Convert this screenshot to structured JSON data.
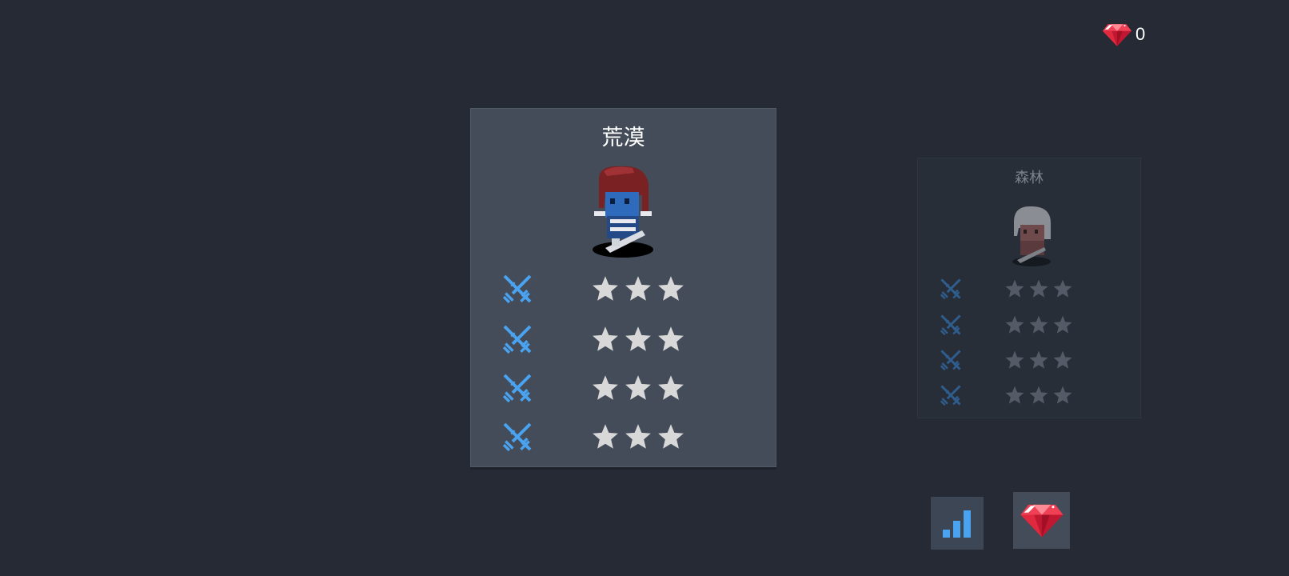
{
  "currency": {
    "icon": "ruby-gem-icon",
    "count": "0",
    "color": "#e0283e"
  },
  "levels": [
    {
      "name": "荒漠",
      "state": "selected",
      "character_icon": "blue-skinned-swordsman-icon",
      "rows": [
        {
          "icon": "crossed-swords-icon",
          "stars_earned": 0,
          "stars_total": 3
        },
        {
          "icon": "crossed-swords-icon",
          "stars_earned": 0,
          "stars_total": 3
        },
        {
          "icon": "crossed-swords-icon",
          "stars_earned": 0,
          "stars_total": 3
        },
        {
          "icon": "crossed-swords-icon",
          "stars_earned": 0,
          "stars_total": 3
        }
      ]
    },
    {
      "name": "森林",
      "state": "dimmed",
      "character_icon": "white-haired-swordsman-icon",
      "rows": [
        {
          "icon": "crossed-swords-icon",
          "stars_earned": 0,
          "stars_total": 3
        },
        {
          "icon": "crossed-swords-icon",
          "stars_earned": 0,
          "stars_total": 3
        },
        {
          "icon": "crossed-swords-icon",
          "stars_earned": 0,
          "stars_total": 3
        },
        {
          "icon": "crossed-swords-icon",
          "stars_earned": 0,
          "stars_total": 3
        }
      ]
    }
  ],
  "buttons": [
    {
      "name": "stats",
      "icon": "bar-chart-icon"
    },
    {
      "name": "shop",
      "icon": "ruby-gem-icon"
    }
  ],
  "colors": {
    "accent_blue": "#4aa3f0",
    "star_active": "#d8d8d8",
    "star_dim": "#545b66",
    "gem_red": "#e0283e"
  }
}
